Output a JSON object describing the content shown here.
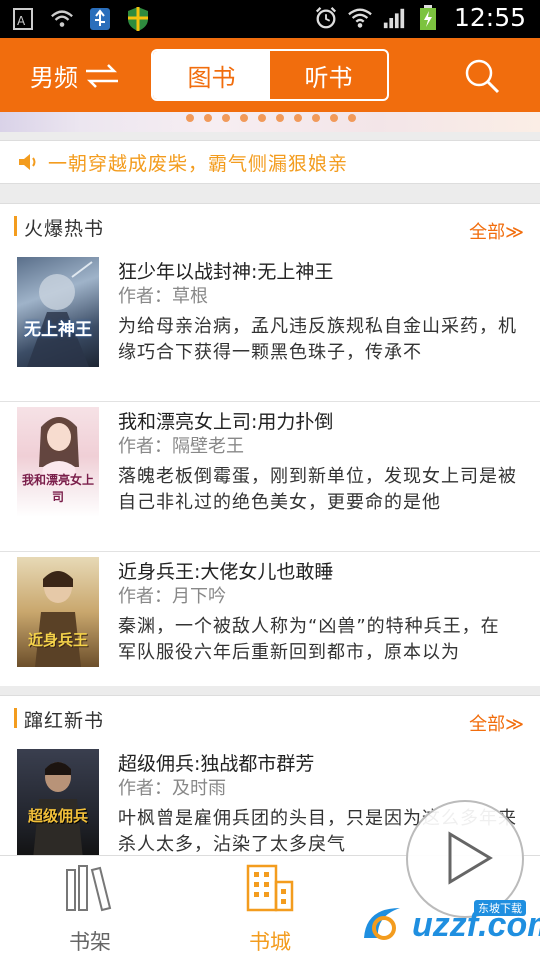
{
  "statusbar": {
    "time": "12:55",
    "icons": [
      "keyboard-icon",
      "wifi-signal-icon",
      "usb-icon",
      "shield-icon",
      "alarm-icon",
      "wifi-icon",
      "cell-signal-icon",
      "battery-charging-icon"
    ]
  },
  "header": {
    "gender_label": "男频",
    "tabs": [
      {
        "label": "图书",
        "active": true
      },
      {
        "label": "听书",
        "active": false
      }
    ],
    "accent": "#f16d0d"
  },
  "notice": {
    "text": "一朝穿越成废柴，霸气侧漏狠娘亲"
  },
  "hot": {
    "title": "火爆热书",
    "more": "全部≫",
    "books": [
      {
        "title": "狂少年以战封神:无上神王",
        "author": "作者：草根",
        "desc": "为给母亲治病，孟凡违反族规私自金山采药，机缘巧合下获得一颗黑色珠子，传承不",
        "cover_text": "无上神王"
      },
      {
        "title": "我和漂亮女上司:用力扑倒",
        "author": "作者：隔壁老王",
        "desc": "落魄老板倒霉蛋，刚到新单位，发现女上司是被自己非礼过的绝色美女，更要命的是他",
        "cover_text": "我和漂亮女上司"
      },
      {
        "title": "近身兵王:大佬女儿也敢睡",
        "author": "作者：月下吟",
        "desc": "秦渊，一个被敌人称为“凶兽”的特种兵王，在军队服役六年后重新回到都市，原本以为",
        "cover_text": "近身兵王"
      }
    ]
  },
  "new": {
    "title": "蹿红新书",
    "more": "全部≫",
    "books": [
      {
        "title": "超级佣兵:独战都市群芳",
        "author": "作者：及时雨",
        "desc": "叶枫曾是雇佣兵团的头目，只是因为这么多年来杀人太多，沾染了太多戾气",
        "cover_text": "超级佣兵"
      }
    ]
  },
  "bottomnav": {
    "items": [
      {
        "label": "书架",
        "active": false
      },
      {
        "label": "书城",
        "active": true
      }
    ]
  },
  "watermark": {
    "text": "uzzf.com",
    "tag": "东坡下载"
  }
}
